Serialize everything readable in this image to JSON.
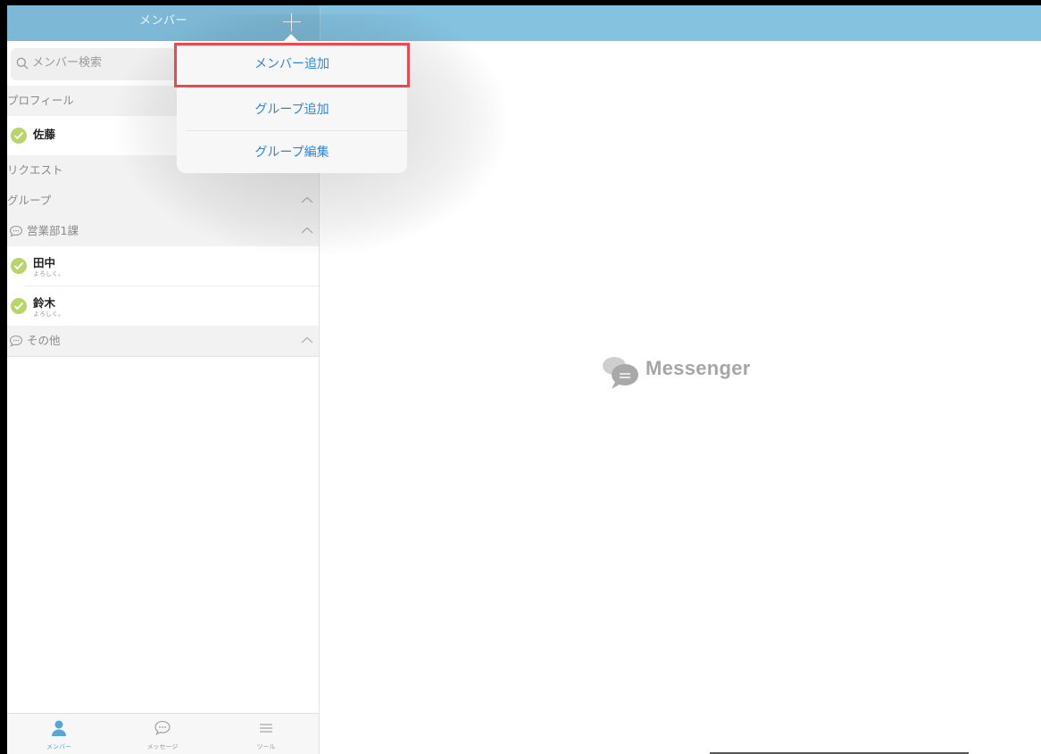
{
  "header": {
    "title": "メンバー"
  },
  "search": {
    "placeholder": "メンバー検索"
  },
  "sidebar": {
    "profile_section": "プロフィール",
    "profile_member": {
      "name": "佐藤"
    },
    "request_section": "リクエスト",
    "group_section": "グループ",
    "groups": [
      {
        "name": "営業部1課",
        "members": [
          {
            "name": "田中",
            "status": "よろしく。"
          },
          {
            "name": "鈴木",
            "status": "よろしく。"
          }
        ]
      },
      {
        "name": "その他",
        "members": []
      }
    ]
  },
  "popover": {
    "items": [
      {
        "label": "メンバー追加"
      },
      {
        "label": "グループ追加"
      },
      {
        "label": "グループ編集"
      }
    ],
    "highlight_color": "#e84a52"
  },
  "main": {
    "logo_text": "Messenger"
  },
  "tabbar": {
    "tabs": [
      {
        "label": "メンバー",
        "icon": "person-icon",
        "active": true
      },
      {
        "label": "メッセージ",
        "icon": "chat-bubble-icon",
        "active": false
      },
      {
        "label": "ツール",
        "icon": "menu-lines-icon",
        "active": false
      }
    ]
  },
  "colors": {
    "header": "#84c2e0",
    "accent": "#2f86d8",
    "online": "#b8d46a",
    "active_tab": "#58a7d2"
  }
}
